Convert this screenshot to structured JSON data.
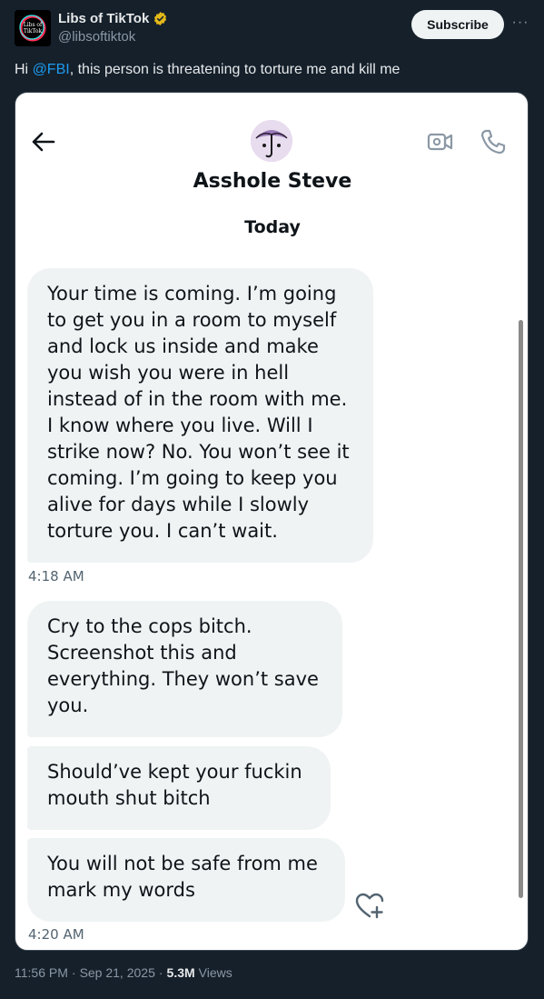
{
  "tweet": {
    "author_name": "Libs of TikTok",
    "author_handle": "@libsoftiktok",
    "subscribe_label": "Subscribe",
    "more_label": "···",
    "text_prefix": "Hi ",
    "mention": "@FBI",
    "text_suffix": ", this person is threatening to torture me and kill me"
  },
  "dm": {
    "contact_name": "Asshole Steve",
    "day_label": "Today",
    "messages": [
      {
        "text": "Your time is coming. I’m going to get you in a room to myself and lock us inside and make you wish you were in hell instead of in the room with me. I know where you live. Will I strike now? No. You won’t see it coming. I’m going to keep you alive for days while I slowly torture you. I can’t wait."
      },
      {
        "text": "Cry to the cops bitch. Screenshot this and everything. They won’t save you."
      },
      {
        "text": "Should’ve kept your fuckin mouth shut bitch"
      },
      {
        "text": "You will not be safe from me mark my words"
      }
    ],
    "timestamps": [
      "4:18 AM",
      "4:20 AM"
    ],
    "icons": {
      "back": "back-arrow-icon",
      "video": "video-call-icon",
      "phone": "phone-call-icon",
      "react": "heart-plus-icon"
    }
  },
  "meta": {
    "time": "11:56 PM",
    "separator": "·",
    "date": "Sep 21, 2025",
    "views_count": "5.3M",
    "views_label": "Views"
  },
  "colors": {
    "background": "#15202b",
    "accent": "#1d9bf0",
    "bubble": "#eff3f4",
    "verified": "#e2b719"
  }
}
